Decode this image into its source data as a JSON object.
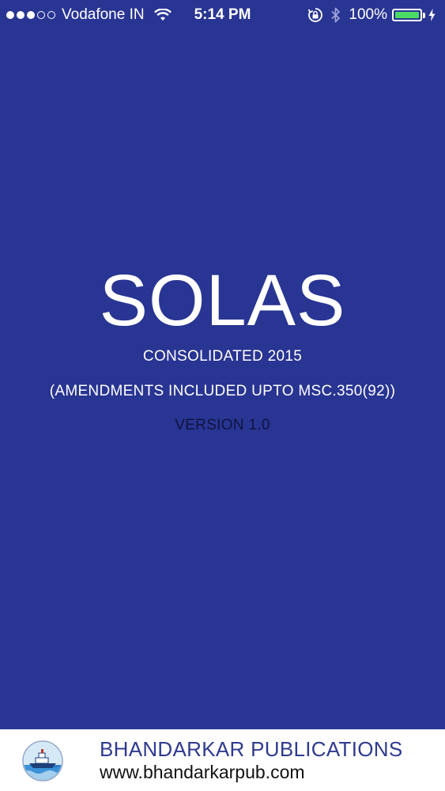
{
  "status_bar": {
    "carrier": "Vodafone IN",
    "time": "5:14 PM",
    "battery_percent": "100%",
    "battery_level": 1.0,
    "signal_bars_filled": 3,
    "signal_bars_total": 5,
    "icons": [
      "signal-dots-icon",
      "wifi-icon",
      "orientation-lock-icon",
      "bluetooth-icon",
      "battery-icon",
      "charging-bolt-icon"
    ]
  },
  "splash": {
    "title": "SOLAS",
    "consolidated": "CONSOLIDATED 2015",
    "amendments": "(AMENDMENTS INCLUDED UPTO MSC.350(92))",
    "version": "VERSION 1.0"
  },
  "footer": {
    "logo_icon": "ship-logo-icon",
    "publisher": "BHANDARKAR PUBLICATIONS",
    "website": "www.bhandarkarpub.com"
  },
  "colors": {
    "background": "#293593",
    "footer_background": "#ffffff",
    "publisher_text": "#2f3a8f",
    "battery_fill": "#4cd964"
  }
}
